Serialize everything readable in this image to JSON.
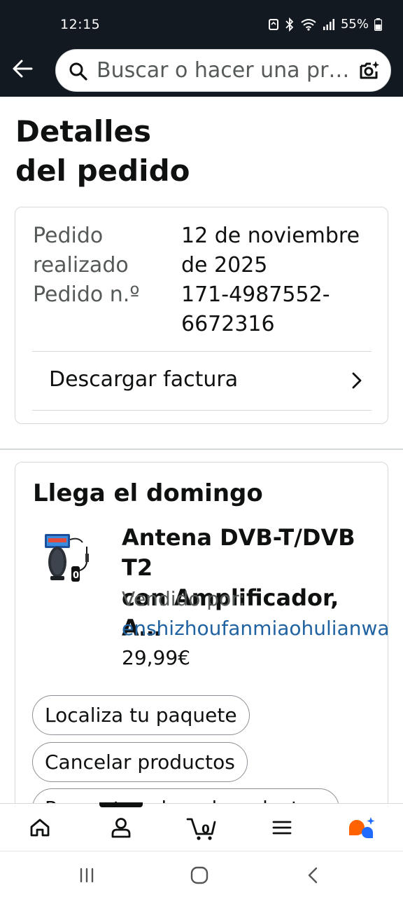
{
  "status_bar": {
    "time": "12:15",
    "battery": "55%",
    "icons": [
      "recycle-icon",
      "bluetooth-icon",
      "wifi-icon",
      "signal-icon",
      "battery-icon"
    ]
  },
  "search": {
    "placeholder": "Buscar o hacer una pr…"
  },
  "page": {
    "title_line1": "Detalles",
    "title_line2": "del pedido"
  },
  "order": {
    "placed_label_1": "Pedido",
    "placed_label_2": "realizado",
    "placed_value_1": "12 de noviembre",
    "placed_value_2": "de 2025",
    "number_label": "Pedido n.º",
    "number_value_1": "171-4987552-",
    "number_value_2": "6672316",
    "invoice_label": "Descargar factura"
  },
  "shipment": {
    "title": "Llega el domingo",
    "product_title_1": "Antena DVB-T/DVB T2",
    "product_title_2": "con Amplificador, A…",
    "sold_by_label": "Vendido por:",
    "seller": "enshizhoufanmiaohulianwangy",
    "price": "29,99€",
    "buttons": {
      "track": "Localiza tu paquete",
      "cancel": "Cancelar productos",
      "partial": "Pregunta sobre el producto"
    }
  },
  "bottom_nav": {
    "cart_count": "0",
    "items": [
      "home-icon",
      "account-icon",
      "cart-icon",
      "menu-icon",
      "rufus-icon"
    ]
  },
  "colors": {
    "header_bg": "#131921",
    "link": "#2162a1",
    "accent_orange": "#ff6200",
    "accent_blue": "#1f6bff"
  }
}
